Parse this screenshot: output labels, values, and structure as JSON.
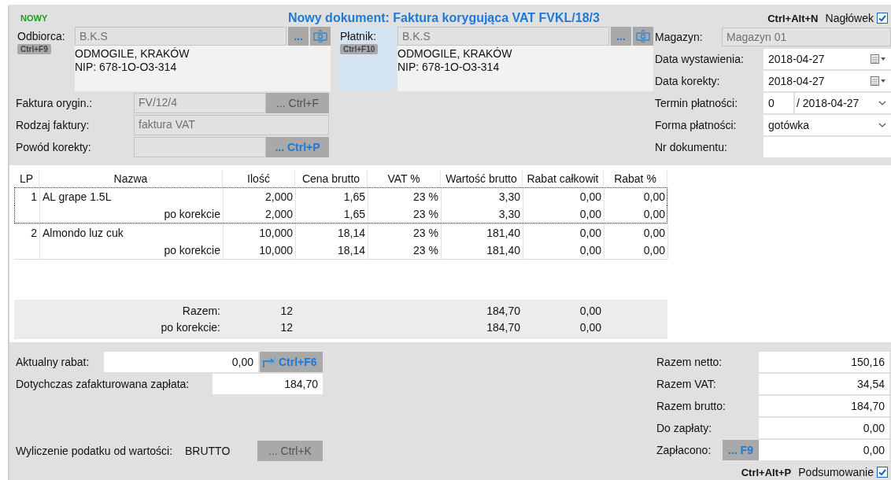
{
  "header": {
    "status": "NOWY",
    "title": "Nowy dokument: Faktura korygująca VAT FVKL/18/3",
    "shortcut": "Ctrl+Alt+N",
    "toggle_label": "Nagłówek",
    "checked": true
  },
  "parties": [
    {
      "label": "Odbiorca:",
      "shortcut": "Ctrl+F9",
      "value": "B.K.S",
      "button": "...",
      "address": [
        "ODMOGILE, KRAKÓW",
        "NIP: 678-1O-O3-314"
      ],
      "highlighted": false
    },
    {
      "label": "Płatnik:",
      "shortcut": "Ctrl+F10",
      "value": "B.K.S",
      "button": "...",
      "address": [
        "ODMOGILE, KRAKÓW",
        "NIP: 678-1O-O3-314"
      ],
      "highlighted": true
    }
  ],
  "invoice_fields": [
    {
      "label": "Faktura orygin.:",
      "value": "FV/12/4",
      "button": "... Ctrl+F",
      "disabled": true
    },
    {
      "label": "Rodzaj faktury:",
      "value": "faktura VAT"
    },
    {
      "label": "Powód korekty:",
      "button": "... Ctrl+P",
      "disabled": false
    }
  ],
  "warehouse": {
    "label": "Magazyn:",
    "value": "Magazyn 01"
  },
  "dates": [
    {
      "label": "Data wystawienia:",
      "kind": "date",
      "value": "2018-04-27"
    },
    {
      "label": "Data korekty:",
      "kind": "date",
      "value": "2018-04-27"
    },
    {
      "label": "Termin płatności:",
      "kind": "term",
      "days": "0",
      "value": "/ 2018-04-27"
    },
    {
      "label": "Forma płatności:",
      "kind": "select",
      "value": "gotówka"
    },
    {
      "label": "Nr dokumentu:",
      "kind": "text"
    }
  ],
  "table": {
    "columns": [
      "LP",
      "Nazwa",
      "Ilość",
      "Cena brutto",
      "VAT %",
      "Wartość brutto",
      "Rabat całkowit",
      "Rabat %"
    ],
    "rows": [
      {
        "kind": "item",
        "cells": [
          "1",
          "AL grape 1.5L",
          "2,000",
          "1,65",
          "23 %",
          "3,30",
          "0,00",
          "0,00"
        ],
        "selected": true
      },
      {
        "kind": "correction",
        "cells": [
          "",
          "po korekcie",
          "2,000",
          "1,65",
          "23 %",
          "3,30",
          "0,00",
          "0,00"
        ],
        "selected": true
      },
      {
        "kind": "item",
        "cells": [
          "2",
          "Almondo luz cuk",
          "10,000",
          "18,14",
          "23 %",
          "181,40",
          "0,00",
          "0,00"
        ],
        "selected": false
      },
      {
        "kind": "correction",
        "cells": [
          "",
          "po korekcie",
          "10,000",
          "18,14",
          "23 %",
          "181,40",
          "0,00",
          "0,00"
        ],
        "selected": false
      }
    ],
    "totals": [
      {
        "cells": [
          "",
          "Razem:",
          "12",
          "",
          "",
          "184,70",
          "0,00",
          ""
        ]
      },
      {
        "cells": [
          "",
          "po korekcie:",
          "12",
          "",
          "",
          "184,70",
          "0,00",
          ""
        ]
      }
    ]
  },
  "discount": {
    "label": "Aktualny rabat:",
    "value": "0,00",
    "button": "Ctrl+F6"
  },
  "paid_so_far": {
    "label": "Dotychczas zafakturowana zapłata:",
    "value": "184,70"
  },
  "tax_basis": {
    "label": "Wyliczenie podatku od wartości:",
    "value": "BRUTTO",
    "button": "... Ctrl+K",
    "disabled": true
  },
  "summary": [
    {
      "label": "Razem netto:",
      "value": "150,16"
    },
    {
      "label": "Razem VAT:",
      "value": "34,54"
    },
    {
      "label": "Razem brutto:",
      "value": "184,70"
    },
    {
      "label": "Do zapłaty:",
      "value": "0,00"
    },
    {
      "label": "Zapłacono:",
      "value": "0,00",
      "button": "... F9"
    }
  ],
  "footer": {
    "shortcut": "Ctrl+Alt+P",
    "toggle_label": "Podsumowanie",
    "checked": true
  }
}
